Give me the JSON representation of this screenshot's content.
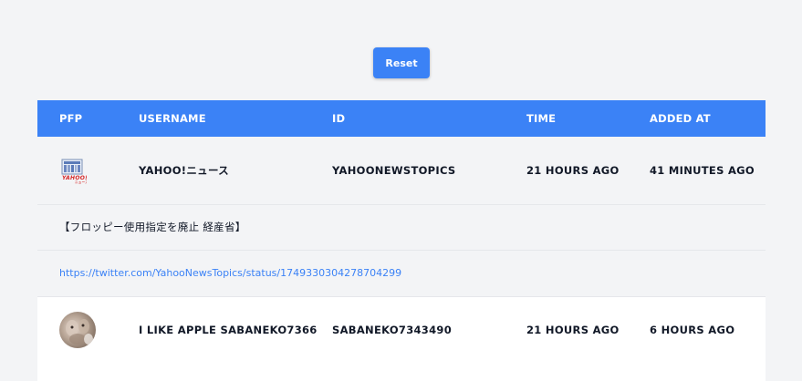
{
  "toolbar": {
    "reset_label": "Reset"
  },
  "table": {
    "columns": [
      "PFP",
      "USERNAME",
      "ID",
      "TIME",
      "ADDED AT"
    ],
    "rows": [
      {
        "pfp": "yahoo-news-logo",
        "username": "YAHOO!ニュース",
        "id": "YAHOONEWSTOPICS",
        "time": "21 HOURS AGO",
        "added_at": "41 MINUTES AGO",
        "text": "【フロッピー使用指定を廃止 経産省】",
        "link": "https://twitter.com/YahooNewsTopics/status/1749330304278704299"
      },
      {
        "pfp": "cat-avatar",
        "username": "I LIKE APPLE SABANEKO7366",
        "id": "SABANEKO7343490",
        "time": "21 HOURS AGO",
        "added_at": "6 HOURS AGO"
      }
    ]
  },
  "colors": {
    "accent": "#3b82f6",
    "background": "#f3f4f6",
    "link": "#3b82f6"
  }
}
